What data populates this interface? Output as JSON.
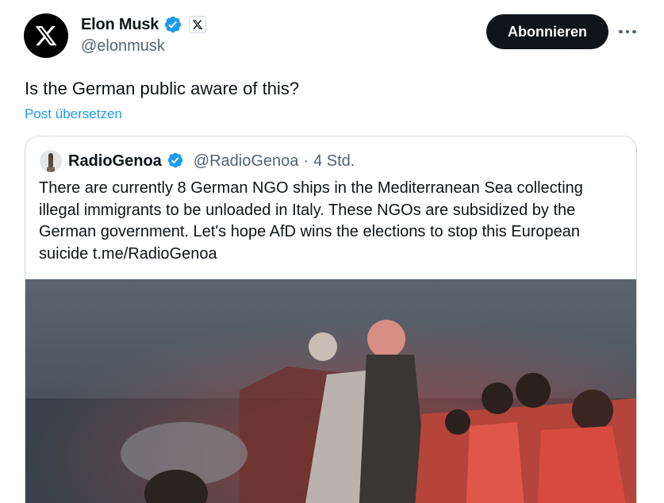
{
  "author": {
    "display_name": "Elon Musk",
    "handle": "@elonmusk",
    "avatar_icon": "x-logo-icon",
    "verified_icon": "verified-badge-icon",
    "affiliation_icon": "x-affiliation-icon"
  },
  "actions": {
    "follow_label": "Abonnieren",
    "more_icon": "more-options-icon"
  },
  "post": {
    "text": "Is the German public aware of this?",
    "translate_label": "Post übersetzen"
  },
  "quoted": {
    "display_name": "RadioGenoa",
    "handle": "@RadioGenoa",
    "separator": "·",
    "time": "4 Std.",
    "text": "There are currently 8 German NGO ships in the Mediterranean Sea collecting illegal immigrants to be unloaded in Italy. These NGOs are subsidized by the German government. Let's hope AfD wins the elections to stop this European suicide t.me/RadioGenoa",
    "media_icon": "video-thumbnail"
  },
  "colors": {
    "accent": "#1d9bf0",
    "text_primary": "#0f1419",
    "text_secondary": "#536471",
    "button_bg": "#0f1419",
    "border": "#cfd9de"
  }
}
